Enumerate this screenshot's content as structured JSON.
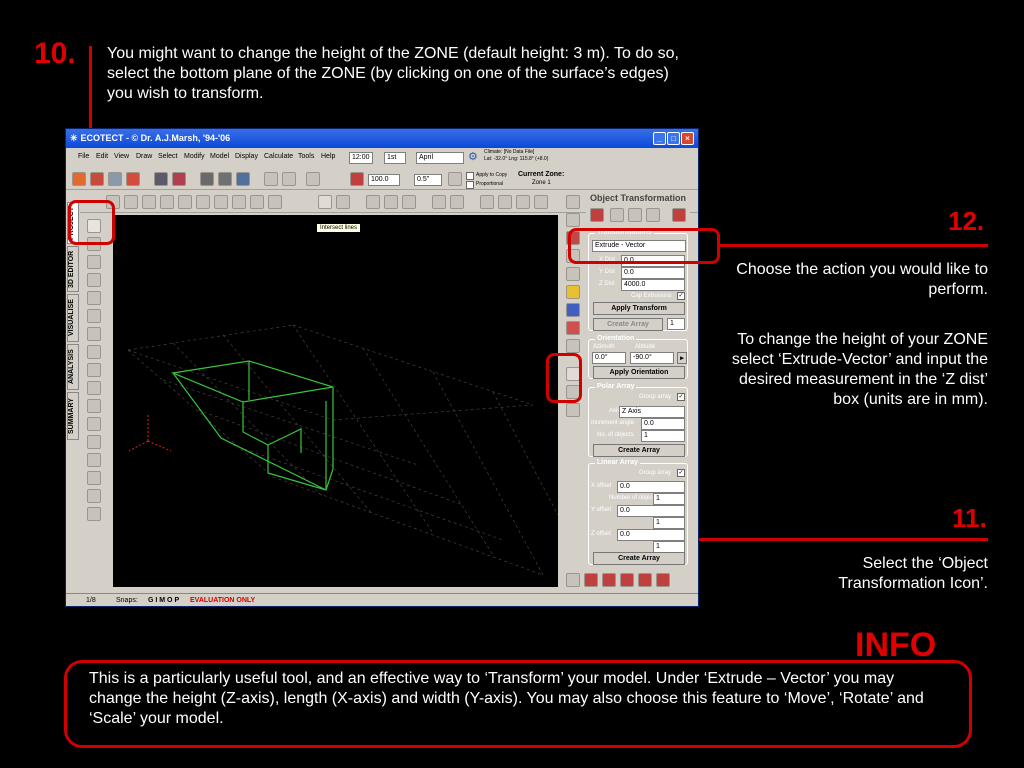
{
  "steps": {
    "s10": {
      "num": "10.",
      "text": "You might want to change the height of the ZONE (default height: 3 m). To do so, select the bottom plane of the ZONE (by clicking on one of the surface’s edges) you wish to transform."
    },
    "s12": {
      "num": "12.",
      "text1": "Choose the action you would like to perform.",
      "text2": "To change the height of your ZONE select ‘Extrude-Vector’ and input the desired measurement in the ‘Z dist’ box (units are in mm)."
    },
    "s11": {
      "num": "11.",
      "text": "Select the ‘Object Transformation Icon’."
    },
    "info": {
      "title": "INFO",
      "text": "This is a particularly useful tool, and an effective way to ‘Transform’ your model.  Under ‘Extrude – Vector’  you may change the height (Z-axis), length (X-axis) and width (Y-axis).  You may also choose this feature to ‘Move’, ‘Rotate’ and ‘Scale’ your model."
    }
  },
  "app": {
    "title": "ECOTECT - © Dr. A.J.Marsh, '94-'06",
    "menus": [
      "File",
      "Edit",
      "View",
      "Draw",
      "Select",
      "Modify",
      "Model",
      "Display",
      "Calculate",
      "Tools",
      "Help"
    ],
    "time": "12:00",
    "day": "1st",
    "month": "April",
    "climate": "Climate: [No Data File]",
    "latlng": "Lat: -32.0° Lng: 115.8° (+8.0)",
    "zoom": "100.0",
    "step": "0.5\"",
    "apply_copy": "Apply to Copy",
    "proportional": "Proportional",
    "current_zone_label": "Current Zone:",
    "current_zone": "Zone 1",
    "tooltip": "Intersect lines",
    "tabs": [
      "PROJECT",
      "3D EDITOR",
      "VISUALISE",
      "ANALYSIS",
      "SUMMARY"
    ],
    "status": {
      "page": "1/8",
      "snaps": "Snaps:",
      "snap_modes": "G I   M O P",
      "eval": "EVALUATION ONLY"
    },
    "panel": {
      "title": "Object Transformation",
      "transformations": {
        "title": "Transformations",
        "select": "Extrude - Vector",
        "xlabel": "X Dist",
        "x": "0.0",
        "ylabel": "Y Dist",
        "y": "0.0",
        "zlabel": "Z Dist",
        "z": "4000.0",
        "cap": "Cap Extrusions",
        "apply": "Apply Transform",
        "create_array": "Create Array",
        "count": "1"
      },
      "orientation": {
        "title": "Orientation",
        "az_label": "Azimuth",
        "alt_label": "Altitude",
        "az": "0.0°",
        "alt": "-90.0°",
        "apply": "Apply Orientation"
      },
      "polar": {
        "title": "Polar Array",
        "group": "Group array",
        "axis_label": "Axis",
        "axis": "Z Axis",
        "inc_label": "Increment angle",
        "inc": "0.0",
        "num_label": "No. of objects",
        "num": "1",
        "create": "Create Array"
      },
      "linear": {
        "title": "Linear Array",
        "group": "Group array",
        "x_label": "X offset",
        "x": "0.0",
        "num_label": "Number of objects",
        "num": "1",
        "y_label": "Y offset",
        "y": "0.0",
        "num2": "1",
        "z_label": "Z offset",
        "z": "0.0",
        "num3": "1",
        "create": "Create Array"
      }
    }
  }
}
